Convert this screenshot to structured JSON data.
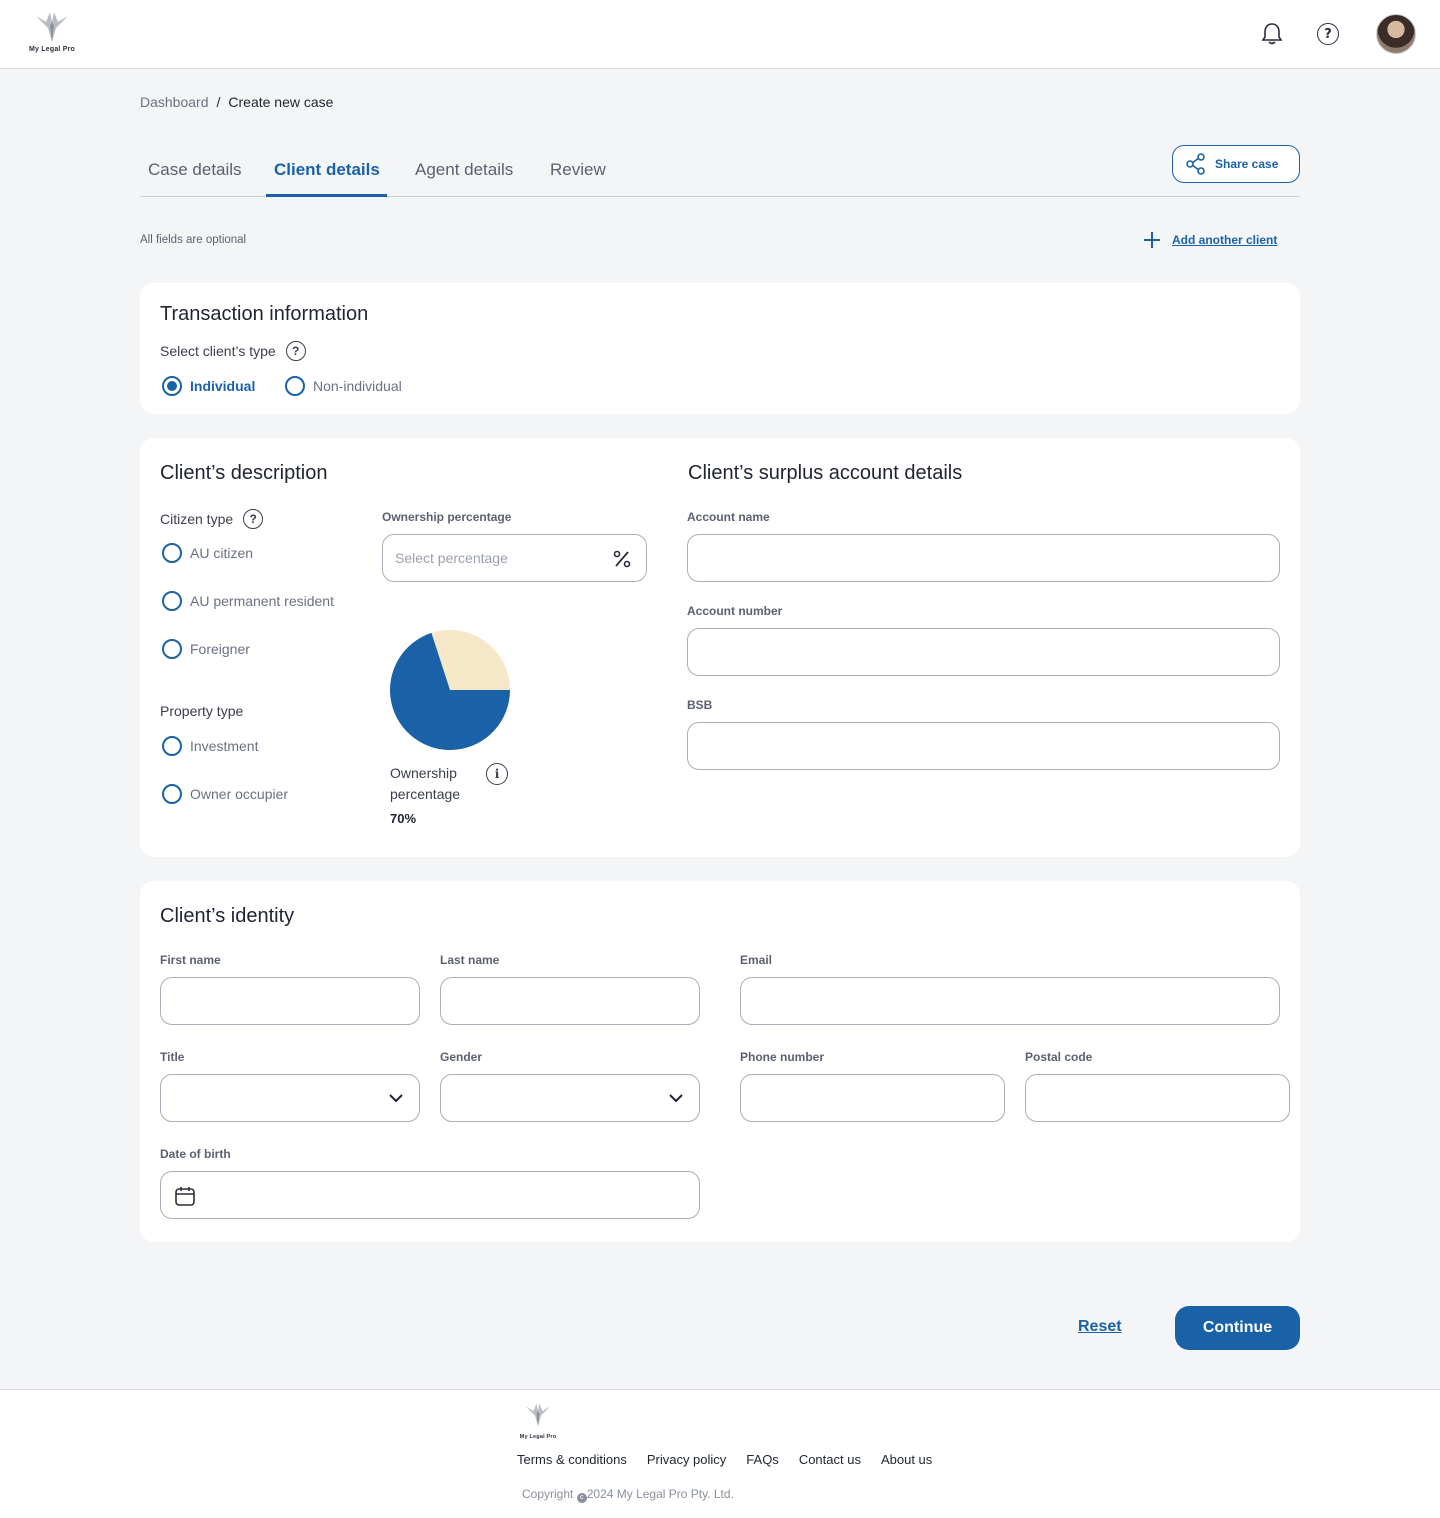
{
  "brand": {
    "name": "My Legal Pro"
  },
  "header": {
    "icons": [
      "bell-icon",
      "help-icon"
    ],
    "avatar_alt": ""
  },
  "breadcrumb": {
    "parent": "Dashboard",
    "separator": "/",
    "current": "Create new case"
  },
  "tabs": [
    {
      "label": "Case details"
    },
    {
      "label": "Client details",
      "active": true
    },
    {
      "label": "Agent details"
    },
    {
      "label": "Review"
    }
  ],
  "share_button": {
    "label": "Share case"
  },
  "note": "All fields are optional",
  "add_client": {
    "label": "Add another client"
  },
  "transaction": {
    "title": "Transaction information",
    "client_type_label": "Select client’s type",
    "options": [
      {
        "label": "Individual",
        "checked": true
      },
      {
        "label": "Non-individual",
        "checked": false
      }
    ]
  },
  "description": {
    "title": "Client’s description",
    "citizen_label": "Citizen type",
    "citizen_options": [
      "AU citizen",
      "AU permanent resident",
      "Foreigner"
    ],
    "property_label": "Property type",
    "property_options": [
      "Investment",
      "Owner occupier"
    ],
    "ownership": {
      "label": "Ownership percentage",
      "placeholder": "Select percentage",
      "caption_line1": "Ownership",
      "caption_line2": "percentage",
      "value_text": "70%",
      "value": 70,
      "colors": {
        "owned": "#1a62a8",
        "rest": "#f6e7c8"
      }
    }
  },
  "surplus": {
    "title": "Client’s surplus account details",
    "fields": [
      "Account name",
      "Account number",
      "BSB"
    ]
  },
  "identity": {
    "title": "Client’s identity",
    "first_name": "First name",
    "last_name": "Last name",
    "email": "Email",
    "title_field": "Title",
    "gender": "Gender",
    "phone": "Phone number",
    "postal": "Postal code",
    "dob": "Date of birth"
  },
  "actions": {
    "reset": "Reset",
    "continue": "Continue"
  },
  "footer": {
    "links": [
      "Terms & conditions",
      "Privacy policy",
      "FAQs",
      "Contact us",
      "About us"
    ],
    "copyright_prefix": "Copyright ",
    "copyright_rest": "2024 My Legal Pro Pty. Ltd."
  },
  "colors": {
    "primary": "#1a62a8",
    "background": "#f4f5f7"
  }
}
